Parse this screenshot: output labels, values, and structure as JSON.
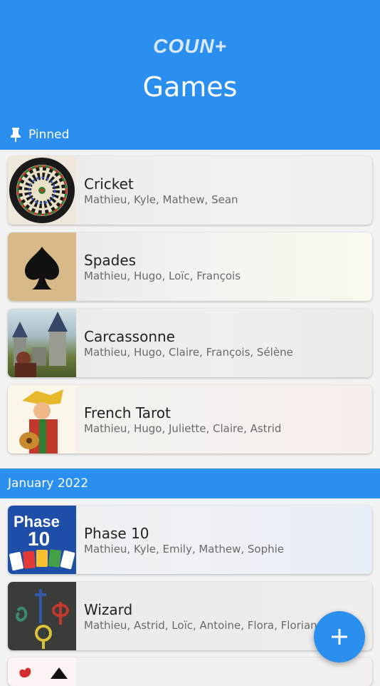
{
  "app": {
    "logo_text": "COUN+",
    "title": "Games"
  },
  "pinned": {
    "label": "Pinned"
  },
  "pinned_games": [
    {
      "name": "Cricket",
      "players": "Mathieu, Kyle, Mathew, Sean",
      "icon": "dartboard-icon"
    },
    {
      "name": "Spades",
      "players": "Mathieu, Hugo, Loïc, François",
      "icon": "spade-icon"
    },
    {
      "name": "Carcassonne",
      "players": "Mathieu, Hugo, Claire, François, Sélène",
      "icon": "carcassonne-art-icon"
    },
    {
      "name": "French Tarot",
      "players": "Mathieu, Hugo, Juliette, Claire, Astrid",
      "icon": "tarot-jester-icon"
    }
  ],
  "sections": [
    {
      "label": "January 2022",
      "games": [
        {
          "name": "Phase 10",
          "players": "Mathieu, Kyle, Emily, Mathew, Sophie",
          "icon": "phase10-logo-icon"
        },
        {
          "name": "Wizard",
          "players": "Mathieu, Astrid, Loïc, Antoine, Flora, Florian",
          "icon": "wizard-symbols-icon"
        }
      ]
    }
  ],
  "fab": {
    "icon": "plus-icon"
  },
  "colors": {
    "primary": "#2b8ff0",
    "background": "#f2f2f2"
  }
}
